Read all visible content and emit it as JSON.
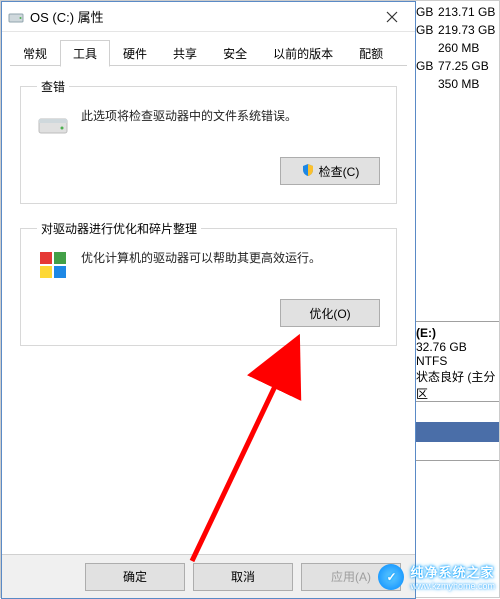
{
  "background": {
    "rows": [
      {
        "unit": "GB",
        "size": "213.71 GB"
      },
      {
        "unit": "GB",
        "size": "219.73 GB"
      },
      {
        "unit": "",
        "size": "260 MB"
      },
      {
        "unit": "GB",
        "size": "77.25 GB"
      },
      {
        "unit": "",
        "size": "350 MB"
      }
    ],
    "panel": {
      "drive": "(E:)",
      "size": "32.76 GB NTFS",
      "status": "状态良好 (主分区"
    }
  },
  "dialog": {
    "title": "OS (C:) 属性",
    "tabs": [
      "常规",
      "工具",
      "硬件",
      "共享",
      "安全",
      "以前的版本",
      "配额"
    ],
    "active_tab_index": 1,
    "error_check": {
      "legend": "查错",
      "desc": "此选项将检查驱动器中的文件系统错误。",
      "button": "检查(C)"
    },
    "optimize": {
      "legend": "对驱动器进行优化和碎片整理",
      "desc": "优化计算机的驱动器可以帮助其更高效运行。",
      "button": "优化(O)"
    },
    "footer": {
      "ok": "确定",
      "cancel": "取消",
      "apply": "应用(A)"
    }
  },
  "watermark": {
    "line1": "纯净系统之家",
    "line2": "www.kzmyhome.com"
  }
}
